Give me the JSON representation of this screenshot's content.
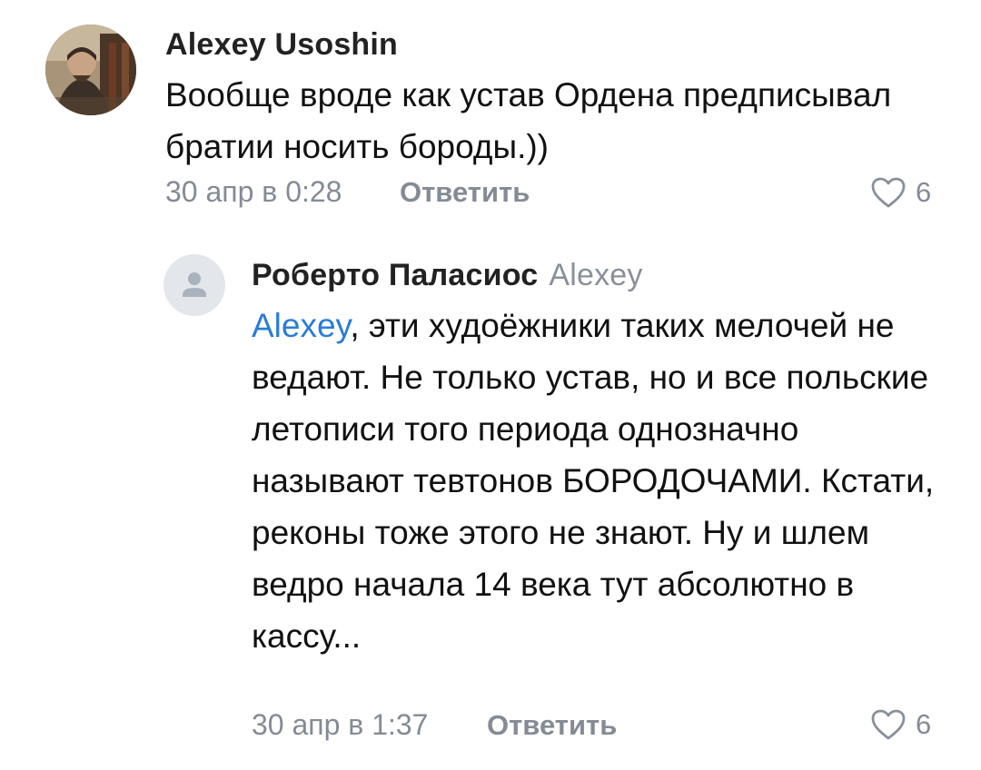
{
  "comments": [
    {
      "author": "Alexey Usoshin",
      "text": "Вообще вроде как устав Ордена предписывал братии носить бороды.))",
      "date": "30 апр в 0:28",
      "reply_label": "Ответить",
      "likes": "6",
      "avatar": "user-photo"
    },
    {
      "author": "Роберто Паласиос",
      "reply_to": "Alexey",
      "mention": "Alexey",
      "text": ", эти худоёжники таких мелочей не ведают. Не только устав, но и все польские летописи того периода однозначно называют тевтонов БОРОДОЧАМИ. Кстати, реконы тоже этого не знают. Ну и шлем ведро начала 14 века тут абсолютно в кассу...",
      "date": "30 апр в 1:37",
      "reply_label": "Ответить",
      "likes": "6",
      "avatar": "default-user-icon"
    }
  ],
  "colors": {
    "mention": "#2a7dd6",
    "meta": "#858b94",
    "avatar_placeholder": "#e3e7ec"
  }
}
